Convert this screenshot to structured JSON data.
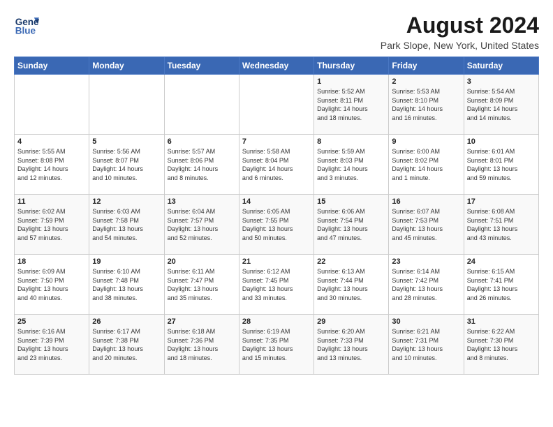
{
  "header": {
    "logo_line1": "General",
    "logo_line2": "Blue",
    "main_title": "August 2024",
    "subtitle": "Park Slope, New York, United States"
  },
  "weekdays": [
    "Sunday",
    "Monday",
    "Tuesday",
    "Wednesday",
    "Thursday",
    "Friday",
    "Saturday"
  ],
  "weeks": [
    [
      {
        "day": "",
        "info": ""
      },
      {
        "day": "",
        "info": ""
      },
      {
        "day": "",
        "info": ""
      },
      {
        "day": "",
        "info": ""
      },
      {
        "day": "1",
        "info": "Sunrise: 5:52 AM\nSunset: 8:11 PM\nDaylight: 14 hours\nand 18 minutes."
      },
      {
        "day": "2",
        "info": "Sunrise: 5:53 AM\nSunset: 8:10 PM\nDaylight: 14 hours\nand 16 minutes."
      },
      {
        "day": "3",
        "info": "Sunrise: 5:54 AM\nSunset: 8:09 PM\nDaylight: 14 hours\nand 14 minutes."
      }
    ],
    [
      {
        "day": "4",
        "info": "Sunrise: 5:55 AM\nSunset: 8:08 PM\nDaylight: 14 hours\nand 12 minutes."
      },
      {
        "day": "5",
        "info": "Sunrise: 5:56 AM\nSunset: 8:07 PM\nDaylight: 14 hours\nand 10 minutes."
      },
      {
        "day": "6",
        "info": "Sunrise: 5:57 AM\nSunset: 8:06 PM\nDaylight: 14 hours\nand 8 minutes."
      },
      {
        "day": "7",
        "info": "Sunrise: 5:58 AM\nSunset: 8:04 PM\nDaylight: 14 hours\nand 6 minutes."
      },
      {
        "day": "8",
        "info": "Sunrise: 5:59 AM\nSunset: 8:03 PM\nDaylight: 14 hours\nand 3 minutes."
      },
      {
        "day": "9",
        "info": "Sunrise: 6:00 AM\nSunset: 8:02 PM\nDaylight: 14 hours\nand 1 minute."
      },
      {
        "day": "10",
        "info": "Sunrise: 6:01 AM\nSunset: 8:01 PM\nDaylight: 13 hours\nand 59 minutes."
      }
    ],
    [
      {
        "day": "11",
        "info": "Sunrise: 6:02 AM\nSunset: 7:59 PM\nDaylight: 13 hours\nand 57 minutes."
      },
      {
        "day": "12",
        "info": "Sunrise: 6:03 AM\nSunset: 7:58 PM\nDaylight: 13 hours\nand 54 minutes."
      },
      {
        "day": "13",
        "info": "Sunrise: 6:04 AM\nSunset: 7:57 PM\nDaylight: 13 hours\nand 52 minutes."
      },
      {
        "day": "14",
        "info": "Sunrise: 6:05 AM\nSunset: 7:55 PM\nDaylight: 13 hours\nand 50 minutes."
      },
      {
        "day": "15",
        "info": "Sunrise: 6:06 AM\nSunset: 7:54 PM\nDaylight: 13 hours\nand 47 minutes."
      },
      {
        "day": "16",
        "info": "Sunrise: 6:07 AM\nSunset: 7:53 PM\nDaylight: 13 hours\nand 45 minutes."
      },
      {
        "day": "17",
        "info": "Sunrise: 6:08 AM\nSunset: 7:51 PM\nDaylight: 13 hours\nand 43 minutes."
      }
    ],
    [
      {
        "day": "18",
        "info": "Sunrise: 6:09 AM\nSunset: 7:50 PM\nDaylight: 13 hours\nand 40 minutes."
      },
      {
        "day": "19",
        "info": "Sunrise: 6:10 AM\nSunset: 7:48 PM\nDaylight: 13 hours\nand 38 minutes."
      },
      {
        "day": "20",
        "info": "Sunrise: 6:11 AM\nSunset: 7:47 PM\nDaylight: 13 hours\nand 35 minutes."
      },
      {
        "day": "21",
        "info": "Sunrise: 6:12 AM\nSunset: 7:45 PM\nDaylight: 13 hours\nand 33 minutes."
      },
      {
        "day": "22",
        "info": "Sunrise: 6:13 AM\nSunset: 7:44 PM\nDaylight: 13 hours\nand 30 minutes."
      },
      {
        "day": "23",
        "info": "Sunrise: 6:14 AM\nSunset: 7:42 PM\nDaylight: 13 hours\nand 28 minutes."
      },
      {
        "day": "24",
        "info": "Sunrise: 6:15 AM\nSunset: 7:41 PM\nDaylight: 13 hours\nand 26 minutes."
      }
    ],
    [
      {
        "day": "25",
        "info": "Sunrise: 6:16 AM\nSunset: 7:39 PM\nDaylight: 13 hours\nand 23 minutes."
      },
      {
        "day": "26",
        "info": "Sunrise: 6:17 AM\nSunset: 7:38 PM\nDaylight: 13 hours\nand 20 minutes."
      },
      {
        "day": "27",
        "info": "Sunrise: 6:18 AM\nSunset: 7:36 PM\nDaylight: 13 hours\nand 18 minutes."
      },
      {
        "day": "28",
        "info": "Sunrise: 6:19 AM\nSunset: 7:35 PM\nDaylight: 13 hours\nand 15 minutes."
      },
      {
        "day": "29",
        "info": "Sunrise: 6:20 AM\nSunset: 7:33 PM\nDaylight: 13 hours\nand 13 minutes."
      },
      {
        "day": "30",
        "info": "Sunrise: 6:21 AM\nSunset: 7:31 PM\nDaylight: 13 hours\nand 10 minutes."
      },
      {
        "day": "31",
        "info": "Sunrise: 6:22 AM\nSunset: 7:30 PM\nDaylight: 13 hours\nand 8 minutes."
      }
    ]
  ]
}
